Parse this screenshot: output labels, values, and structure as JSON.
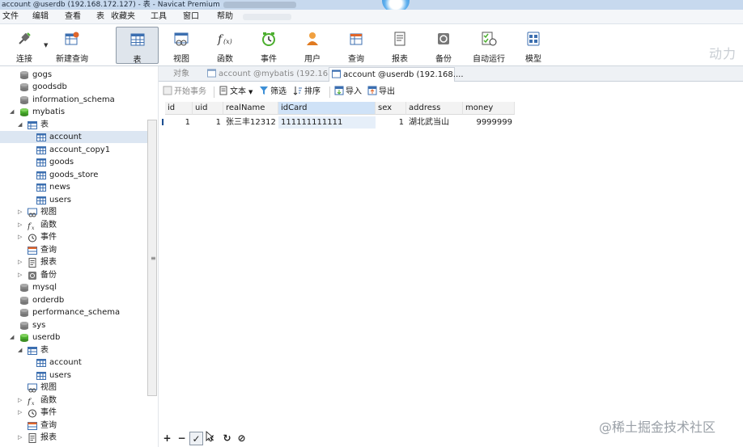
{
  "window": {
    "title": "account @userdb (192.168.172.127) - 表 - Navicat Premium"
  },
  "menu": [
    "文件",
    "编辑",
    "查看",
    "表",
    "收藏夹",
    "工具",
    "窗口",
    "帮助"
  ],
  "toolbar": {
    "buttons": [
      {
        "label": "连接",
        "icon": "connection-plug-icon"
      },
      {
        "label": "新建查询",
        "icon": "new-query-icon"
      },
      {
        "label": "表",
        "icon": "table-icon",
        "active": true
      },
      {
        "label": "视图",
        "icon": "view-icon"
      },
      {
        "label": "函数",
        "icon": "function-icon"
      },
      {
        "label": "事件",
        "icon": "event-clock-icon"
      },
      {
        "label": "用户",
        "icon": "user-icon"
      },
      {
        "label": "查询",
        "icon": "query-icon"
      },
      {
        "label": "报表",
        "icon": "report-icon"
      },
      {
        "label": "备份",
        "icon": "backup-icon"
      },
      {
        "label": "自动运行",
        "icon": "auto-run-icon"
      },
      {
        "label": "模型",
        "icon": "model-icon"
      }
    ],
    "watermark": "动力"
  },
  "sidebar": {
    "items": [
      {
        "label": "gogs",
        "icon": "database-icon"
      },
      {
        "label": "goodsdb",
        "icon": "database-icon"
      },
      {
        "label": "information_schema",
        "icon": "database-icon"
      },
      {
        "label": "mybatis",
        "icon": "database-icon",
        "expanded": true
      },
      {
        "label": "表",
        "icon": "tables-folder-icon",
        "expanded": true
      },
      {
        "label": "account",
        "icon": "table-icon",
        "selected": true
      },
      {
        "label": "account_copy1",
        "icon": "table-icon"
      },
      {
        "label": "goods",
        "icon": "table-icon"
      },
      {
        "label": "goods_store",
        "icon": "table-icon"
      },
      {
        "label": "news",
        "icon": "table-icon"
      },
      {
        "label": "users",
        "icon": "table-icon"
      },
      {
        "label": "视图",
        "icon": "view-icon"
      },
      {
        "label": "函数",
        "icon": "function-icon"
      },
      {
        "label": "事件",
        "icon": "event-clock-icon"
      },
      {
        "label": "查询",
        "icon": "query-icon"
      },
      {
        "label": "报表",
        "icon": "report-icon"
      },
      {
        "label": "备份",
        "icon": "backup-icon"
      },
      {
        "label": "mysql",
        "icon": "database-icon"
      },
      {
        "label": "orderdb",
        "icon": "database-icon"
      },
      {
        "label": "performance_schema",
        "icon": "database-icon"
      },
      {
        "label": "sys",
        "icon": "database-icon"
      },
      {
        "label": "userdb",
        "icon": "database-icon",
        "expanded": true
      },
      {
        "label": "表",
        "icon": "tables-folder-icon",
        "expanded": true
      },
      {
        "label": "account",
        "icon": "table-icon"
      },
      {
        "label": "users",
        "icon": "table-icon"
      },
      {
        "label": "视图",
        "icon": "view-icon"
      },
      {
        "label": "函数",
        "icon": "function-icon"
      },
      {
        "label": "事件",
        "icon": "event-clock-icon"
      },
      {
        "label": "查询",
        "icon": "query-icon"
      },
      {
        "label": "报表",
        "icon": "report-icon"
      }
    ]
  },
  "tabs": [
    {
      "label": "对象"
    },
    {
      "label": "account @mybatis (192.168...."
    },
    {
      "label": "account @userdb (192.168....",
      "active": true
    }
  ],
  "grid_toolbar": {
    "begin_transaction": "开始事务",
    "text": "文本",
    "filter": "筛选",
    "sort": "排序",
    "import": "导入",
    "export": "导出"
  },
  "table": {
    "columns": [
      "id",
      "uid",
      "realName",
      "idCard",
      "sex",
      "address",
      "money"
    ],
    "rows": [
      {
        "id": "1",
        "uid": "1",
        "realName": "张三丰12312",
        "idCard": "111111111111",
        "sex": "1",
        "address": "湖北武当山",
        "money": "9999999"
      }
    ]
  },
  "bottom": {
    "add": "+",
    "remove": "−",
    "apply": "✓",
    "discard": "✕",
    "refresh": "↻",
    "stop": "⊘"
  },
  "watermark": "@稀土掘金技术社区",
  "colors": {
    "titlebar": "#c7d9ee",
    "selected_row": "#dce6f2",
    "selected_header": "#cfe2f7",
    "database_green": "#4caf2e"
  }
}
